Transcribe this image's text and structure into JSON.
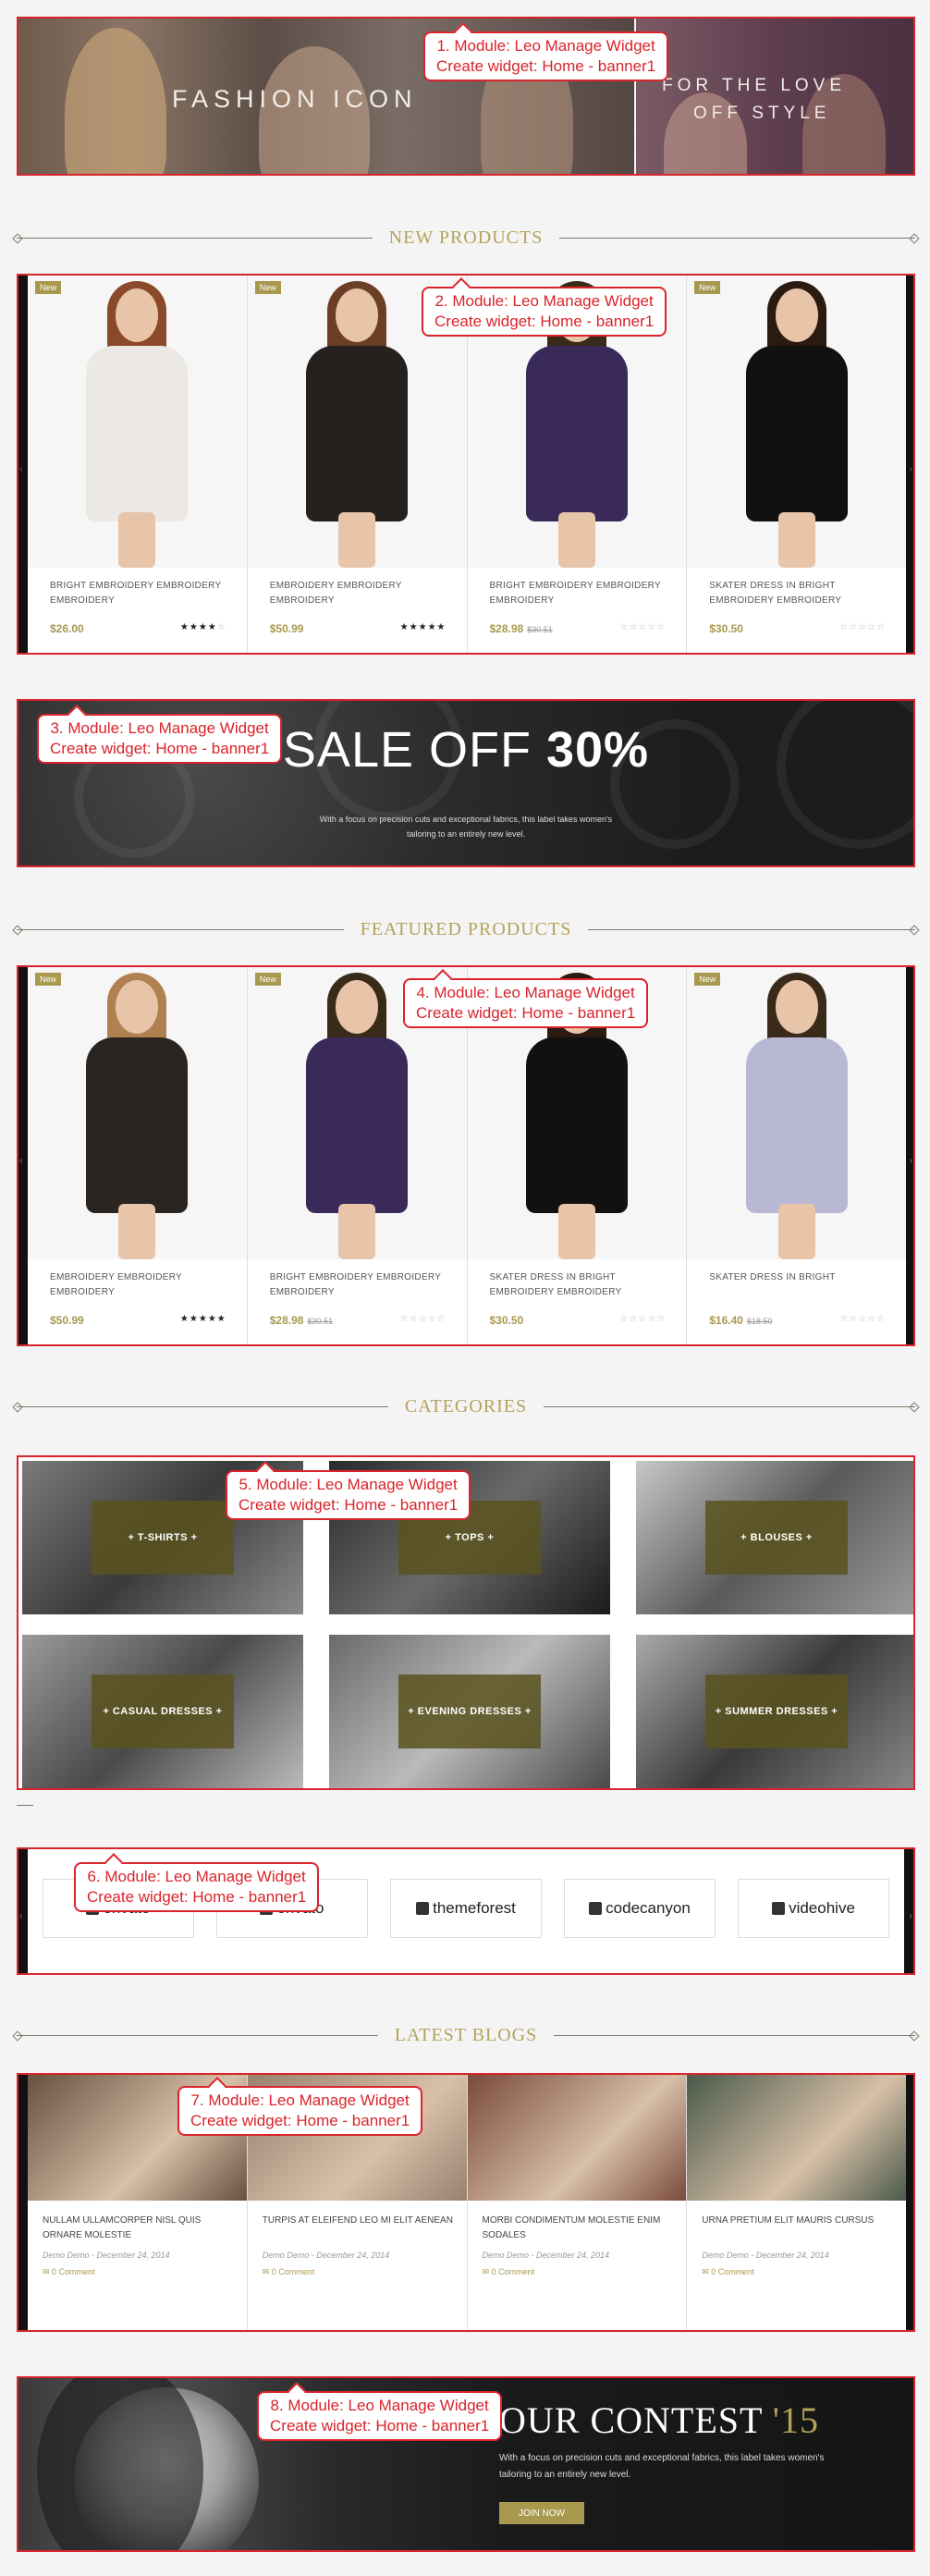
{
  "banner1": {
    "left_text": "FASHION ICON",
    "right_text_1": "FOR THE LOVE",
    "right_text_2": "OFF STYLE"
  },
  "callouts": [
    {
      "line1": "1. Module: Leo Manage Widget",
      "line2": "Create widget: Home - banner1"
    },
    {
      "line1": "2. Module: Leo Manage Widget",
      "line2": "Create widget: Home - banner1"
    },
    {
      "line1": "3. Module: Leo Manage Widget",
      "line2": "Create widget: Home - banner1"
    },
    {
      "line1": "4. Module: Leo Manage Widget",
      "line2": "Create widget: Home - banner1"
    },
    {
      "line1": "5. Module: Leo Manage Widget",
      "line2": "Create widget: Home - banner1"
    },
    {
      "line1": "6. Module: Leo Manage Widget",
      "line2": "Create widget: Home - banner1"
    },
    {
      "line1": "7. Module: Leo Manage Widget",
      "line2": "Create widget: Home - banner1"
    },
    {
      "line1": "8. Module: Leo Manage Widget",
      "line2": "Create widget: Home - banner1"
    }
  ],
  "sections": {
    "new_products": "NEW PRODUCTS",
    "featured_products": "FEATURED PRODUCTS",
    "categories": "CATEGORIES",
    "latest_blogs": "LATEST BLOGS"
  },
  "new_label": "New",
  "new_products": [
    {
      "name": "BRIGHT EMBROIDERY EMBROIDERY EMBROIDERY",
      "price": "$26.00",
      "old_price": "",
      "stars_on": "★★★★",
      "stars_off": "☆",
      "new": true,
      "dress_color": "#ece9e4",
      "hair_color": "#8a4a2a"
    },
    {
      "name": "EMBROIDERY EMBROIDERY EMBROIDERY",
      "price": "$50.99",
      "old_price": "",
      "stars_on": "★★★★★",
      "stars_off": "",
      "new": true,
      "dress_color": "#24211f",
      "hair_color": "#6a3f25"
    },
    {
      "name": "BRIGHT EMBROIDERY EMBROIDERY EMBROIDERY",
      "price": "$28.98",
      "old_price": "$30.51",
      "stars_on": "",
      "stars_off": "☆☆☆☆☆",
      "new": false,
      "dress_color": "#3a2a5a",
      "hair_color": "#3a2a1a"
    },
    {
      "name": "SKATER DRESS IN BRIGHT EMBROIDERY EMBROIDERY",
      "price": "$30.50",
      "old_price": "",
      "stars_on": "",
      "stars_off": "☆☆☆☆☆",
      "new": true,
      "dress_color": "#111111",
      "hair_color": "#2a1a10"
    }
  ],
  "sale": {
    "title_light": "SALE OFF ",
    "title_bold": "30%",
    "sub_1": "With a focus on precision cuts and exceptional fabrics, this label takes women's",
    "sub_2": "tailoring to an entirely new level."
  },
  "featured_products": [
    {
      "name": "EMBROIDERY EMBROIDERY EMBROIDERY",
      "price": "$50.99",
      "old_price": "",
      "stars_on": "★★★★★",
      "stars_off": "",
      "new": true,
      "dress_color": "#2a2520",
      "hair_color": "#b08050"
    },
    {
      "name": "BRIGHT EMBROIDERY EMBROIDERY EMBROIDERY",
      "price": "$28.98",
      "old_price": "$30.51",
      "stars_on": "",
      "stars_off": "☆☆☆☆☆",
      "new": true,
      "dress_color": "#3a2a5a",
      "hair_color": "#3a2a1a"
    },
    {
      "name": "SKATER DRESS IN BRIGHT EMBROIDERY EMBROIDERY",
      "price": "$30.50",
      "old_price": "",
      "stars_on": "",
      "stars_off": "☆☆☆☆☆",
      "new": false,
      "dress_color": "#111111",
      "hair_color": "#2a1a10"
    },
    {
      "name": "SKATER DRESS IN BRIGHT",
      "price": "$16.40",
      "old_price": "$18.50",
      "stars_on": "",
      "stars_off": "☆☆☆☆☆",
      "new": true,
      "dress_color": "#b8b8d4",
      "hair_color": "#3a2a1a"
    }
  ],
  "categories": [
    "+ T-SHIRTS +",
    "+ TOPS +",
    "+ BLOUSES +",
    "+ CASUAL DRESSES +",
    "+ EVENING DRESSES +",
    "+ SUMMER DRESSES +"
  ],
  "brands": [
    {
      "name": "envato",
      "icon": "envato-icon"
    },
    {
      "name": "envato",
      "icon": "envato-logo-icon"
    },
    {
      "name": "themeforest",
      "icon": "themeforest-icon"
    },
    {
      "name": "codecanyon",
      "icon": "codecanyon-icon"
    },
    {
      "name": "videohive",
      "icon": "videohive-icon"
    }
  ],
  "blogs": [
    {
      "title": "NULLAM ULLAMCORPER NISL QUIS ORNARE MOLESTIE",
      "meta": "Demo Demo - December 24, 2014",
      "comments": "0 Comment",
      "img_color": "#6a5040"
    },
    {
      "title": "TURPIS AT ELEIFEND LEO MI ELIT AENEAN",
      "meta": "Demo Demo - December 24, 2014",
      "comments": "0 Comment",
      "img_color": "#9a8070"
    },
    {
      "title": "MORBI CONDIMENTUM MOLESTIE ENIM SODALES",
      "meta": "Demo Demo - December 24, 2014",
      "comments": "0 Comment",
      "img_color": "#7a4a3a"
    },
    {
      "title": "URNA PRETIUM ELIT MAURIS CURSUS",
      "meta": "Demo Demo - December 24, 2014",
      "comments": "0 Comment",
      "img_color": "#4a5a4a"
    }
  ],
  "contest": {
    "title": "OUR CONTEST ",
    "year": "'15",
    "sub_1": "With a focus on precision cuts and exceptional fabrics, this label takes women's",
    "sub_2": "tailoring to an entirely new level.",
    "button": "JOIN NOW"
  },
  "colors": {
    "accent": "#a8994f",
    "callout_red": "#d9242b"
  }
}
